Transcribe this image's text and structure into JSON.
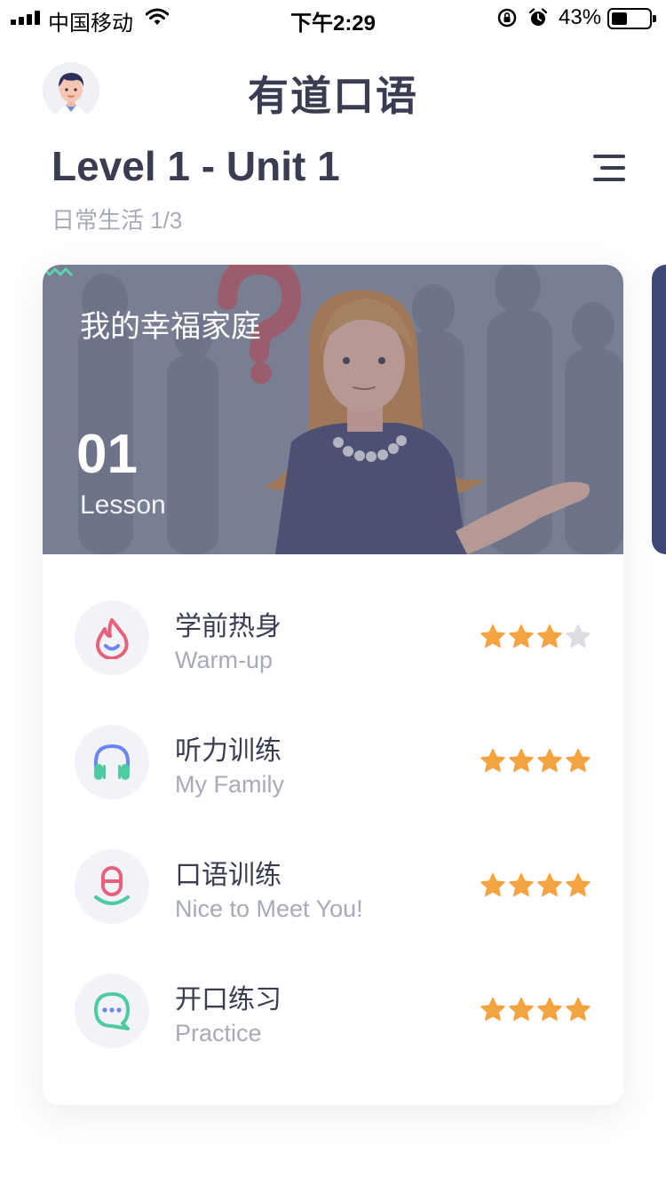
{
  "status_bar": {
    "carrier": "中国移动",
    "time": "下午2:29",
    "battery_pct": "43%",
    "battery_level": 0.43
  },
  "header": {
    "app_title": "有道口语",
    "unit_title": "Level 1 - Unit 1",
    "unit_subtitle": "日常生活 1/3"
  },
  "lesson": {
    "title": "我的幸福家庭",
    "number": "01",
    "label": "Lesson"
  },
  "activities": [
    {
      "title": "学前热身",
      "subtitle": "Warm-up",
      "icon": "flame-icon",
      "stars": 3,
      "max_stars": 4
    },
    {
      "title": "听力训练",
      "subtitle": "My Family",
      "icon": "headphones-icon",
      "stars": 4,
      "max_stars": 4
    },
    {
      "title": "口语训练",
      "subtitle": "Nice to Meet You!",
      "icon": "microphone-icon",
      "stars": 4,
      "max_stars": 4
    },
    {
      "title": "开口练习",
      "subtitle": "Practice",
      "icon": "chat-bubble-icon",
      "stars": 4,
      "max_stars": 4
    }
  ],
  "colors": {
    "text_dark": "#3a3d52",
    "text_muted": "#a7aab8",
    "star_on": "#f4a341",
    "star_off": "#dcdde3",
    "accent_green": "#4fcba0",
    "accent_pink": "#e8617a",
    "accent_blue": "#6a86f2"
  }
}
